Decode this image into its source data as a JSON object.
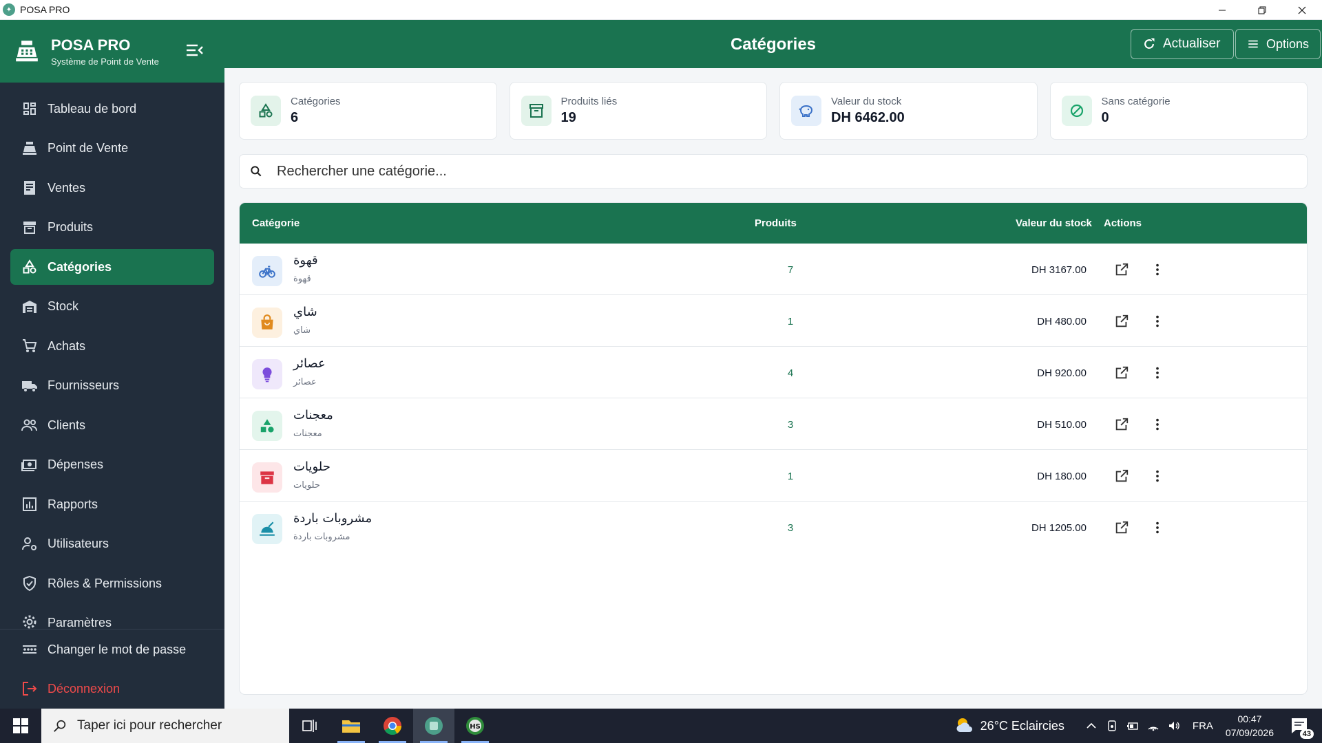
{
  "window": {
    "title": "POSA PRO"
  },
  "brand": {
    "name": "POSA PRO",
    "subtitle": "Système de Point de Vente"
  },
  "nav": {
    "items": [
      {
        "label": "Tableau de bord",
        "icon": "dashboard-icon"
      },
      {
        "label": "Point de Vente",
        "icon": "cash-register-icon"
      },
      {
        "label": "Ventes",
        "icon": "receipt-icon"
      },
      {
        "label": "Produits",
        "icon": "archive-box-icon"
      },
      {
        "label": "Catégories",
        "icon": "shapes-icon",
        "active": true
      },
      {
        "label": "Stock",
        "icon": "warehouse-icon"
      },
      {
        "label": "Achats",
        "icon": "cart-icon"
      },
      {
        "label": "Fournisseurs",
        "icon": "truck-icon"
      },
      {
        "label": "Clients",
        "icon": "users-icon"
      },
      {
        "label": "Dépenses",
        "icon": "cash-icon"
      },
      {
        "label": "Rapports",
        "icon": "bar-chart-icon"
      },
      {
        "label": "Utilisateurs",
        "icon": "user-gear-icon"
      },
      {
        "label": "Rôles & Permissions",
        "icon": "shield-icon"
      },
      {
        "label": "Paramètres",
        "icon": "gear-icon"
      }
    ],
    "change_password": "Changer le mot de passe",
    "logout": "Déconnexion"
  },
  "header": {
    "title": "Catégories",
    "refresh": "Actualiser",
    "options": "Options"
  },
  "stats": [
    {
      "label": "Catégories",
      "value": "6",
      "icon": "shapes-icon",
      "color": "#1a7350",
      "bg": "#e3f3ea"
    },
    {
      "label": "Produits liés",
      "value": "19",
      "icon": "archive-box-icon",
      "color": "#1a7350",
      "bg": "#e3f3ea"
    },
    {
      "label": "Valeur du stock",
      "value": "DH 6462.00",
      "icon": "piggy-bank-icon",
      "color": "#3b72c8",
      "bg": "#e4eefa"
    },
    {
      "label": "Sans catégorie",
      "value": "0",
      "icon": "block-icon",
      "color": "#19a36a",
      "bg": "#e3f5ec"
    }
  ],
  "search": {
    "placeholder": "Rechercher une catégorie..."
  },
  "table": {
    "headers": {
      "category": "Catégorie",
      "products": "Produits",
      "value": "Valeur du stock",
      "actions": "Actions"
    },
    "rows": [
      {
        "name": "قهوة",
        "sub": "قهوة",
        "products": "7",
        "value": "DH 3167.00",
        "icon": "bicycle-icon",
        "color": "#3b72c8",
        "bg": "#e4eefa"
      },
      {
        "name": "شاي",
        "sub": "شاي",
        "products": "1",
        "value": "DH 480.00",
        "icon": "shopping-bag-icon",
        "color": "#e08a1e",
        "bg": "#fdf0df"
      },
      {
        "name": "عصائر",
        "sub": "عصائر",
        "products": "4",
        "value": "DH 920.00",
        "icon": "lightbulb-icon",
        "color": "#7c4ddc",
        "bg": "#efe8fb"
      },
      {
        "name": "معجنات",
        "sub": "معجنات",
        "products": "3",
        "value": "DH 510.00",
        "icon": "shapes-icon",
        "color": "#19a36a",
        "bg": "#e3f5ec"
      },
      {
        "name": "حلويات",
        "sub": "حلويات",
        "products": "1",
        "value": "DH 180.00",
        "icon": "archive-box-icon",
        "color": "#dc3545",
        "bg": "#fde6e8"
      },
      {
        "name": "مشروبات باردة",
        "sub": "مشروبات باردة",
        "products": "3",
        "value": "DH 1205.00",
        "icon": "food-tray-icon",
        "color": "#1b8fa8",
        "bg": "#e1f3f6"
      }
    ]
  },
  "taskbar": {
    "search_placeholder": "Taper ici pour rechercher",
    "weather": "26°C Eclaircies",
    "language": "FRA",
    "time": "00:47",
    "date": "07/09/2026",
    "notifications": "43"
  }
}
